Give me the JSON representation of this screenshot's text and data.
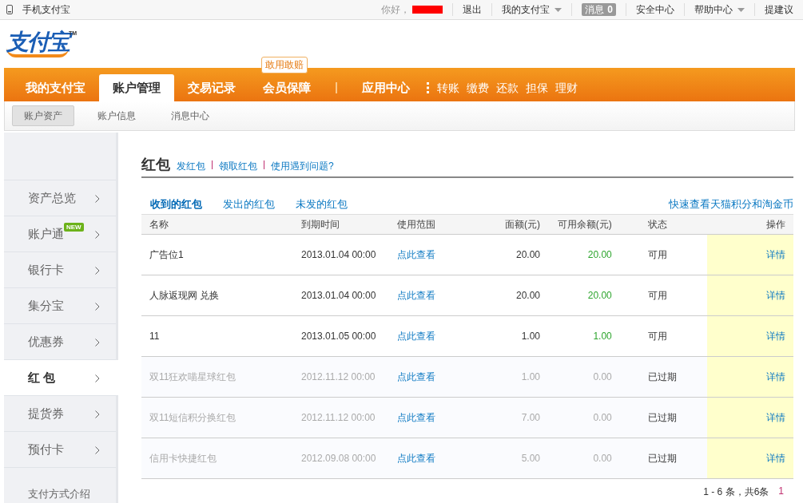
{
  "top_bar": {
    "mobile_link": "手机支付宝",
    "greeting": "你好，",
    "items": [
      {
        "kind": "link",
        "label": "退出",
        "dropdown": false
      },
      {
        "kind": "link",
        "label": "我的支付宝",
        "dropdown": true
      },
      {
        "kind": "messages",
        "label": "消息",
        "count": "0",
        "dropdown": false
      },
      {
        "kind": "link",
        "label": "安全中心",
        "dropdown": false
      },
      {
        "kind": "link",
        "label": "帮助中心",
        "dropdown": true
      },
      {
        "kind": "link",
        "label": "提建议",
        "dropdown": false
      }
    ]
  },
  "logo": {
    "text": "支付宝",
    "mark": "TM"
  },
  "main_nav": {
    "items": [
      {
        "kind": "tab",
        "label": "我的支付宝",
        "selected": false
      },
      {
        "kind": "tab",
        "label": "账户管理",
        "selected": true
      },
      {
        "kind": "tab",
        "label": "交易记录",
        "selected": false
      },
      {
        "kind": "tab",
        "label": "会员保障",
        "selected": false,
        "badge": "敢用敢赔"
      },
      {
        "kind": "divider"
      },
      {
        "kind": "tab",
        "label": "应用中心",
        "selected": false
      },
      {
        "kind": "more"
      },
      {
        "kind": "link",
        "label": "转账"
      },
      {
        "kind": "link",
        "label": "缴费"
      },
      {
        "kind": "link",
        "label": "还款"
      },
      {
        "kind": "link",
        "label": "担保"
      },
      {
        "kind": "link",
        "label": "理财"
      }
    ]
  },
  "sub_nav": {
    "items": [
      {
        "label": "账户资产",
        "selected": true
      },
      {
        "label": "账户信息",
        "selected": false
      },
      {
        "label": "消息中心",
        "selected": false
      }
    ]
  },
  "sidebar": {
    "items": [
      {
        "label": "资产总览",
        "selected": false
      },
      {
        "label": "账户通",
        "selected": false,
        "badge": "NEW"
      },
      {
        "label": "银行卡",
        "selected": false
      },
      {
        "label": "集分宝",
        "selected": false
      },
      {
        "label": "优惠券",
        "selected": false
      },
      {
        "label": "红 包",
        "selected": true
      },
      {
        "label": "提货券",
        "selected": false
      },
      {
        "label": "预付卡",
        "selected": false
      }
    ],
    "footer_link": "支付方式介绍"
  },
  "content": {
    "title": "红包",
    "title_links": [
      "发红包",
      "领取红包",
      "使用遇到问题?"
    ],
    "tabs": [
      {
        "label": "收到的红包",
        "selected": true
      },
      {
        "label": "发出的红包",
        "selected": false
      },
      {
        "label": "未发的红包",
        "selected": false
      }
    ],
    "side_link": "快速查看天猫积分和淘金币",
    "table": {
      "columns": [
        "名称",
        "到期时间",
        "使用范围",
        "面额(元)",
        "可用余额(元)",
        "状态",
        "操作"
      ],
      "rows": [
        {
          "name": "广告位1",
          "expires": "2013.01.04 00:00",
          "scope": "点此查看",
          "amount": "20.00",
          "balance": "20.00",
          "status": "可用",
          "action": "详情",
          "expired": false
        },
        {
          "name": "人脉返现网 兑换",
          "expires": "2013.01.04 00:00",
          "scope": "点此查看",
          "amount": "20.00",
          "balance": "20.00",
          "status": "可用",
          "action": "详情",
          "expired": false
        },
        {
          "name": "11",
          "expires": "2013.01.05 00:00",
          "scope": "点此查看",
          "amount": "1.00",
          "balance": "1.00",
          "status": "可用",
          "action": "详情",
          "expired": false
        },
        {
          "name": "双11狂欢喵星球红包",
          "expires": "2012.11.12 00:00",
          "scope": "点此查看",
          "amount": "1.00",
          "balance": "0.00",
          "status": "已过期",
          "action": "详情",
          "expired": true
        },
        {
          "name": "双11短信积分换红包",
          "expires": "2012.11.12 00:00",
          "scope": "点此查看",
          "amount": "7.00",
          "balance": "0.00",
          "status": "已过期",
          "action": "详情",
          "expired": true
        },
        {
          "name": "信用卡快捷红包",
          "expires": "2012.09.08 00:00",
          "scope": "点此查看",
          "amount": "5.00",
          "balance": "0.00",
          "status": "已过期",
          "action": "详情",
          "expired": true
        }
      ]
    },
    "pagination": {
      "summary": "1 - 6 条，共6条",
      "pages": [
        "1"
      ]
    }
  }
}
